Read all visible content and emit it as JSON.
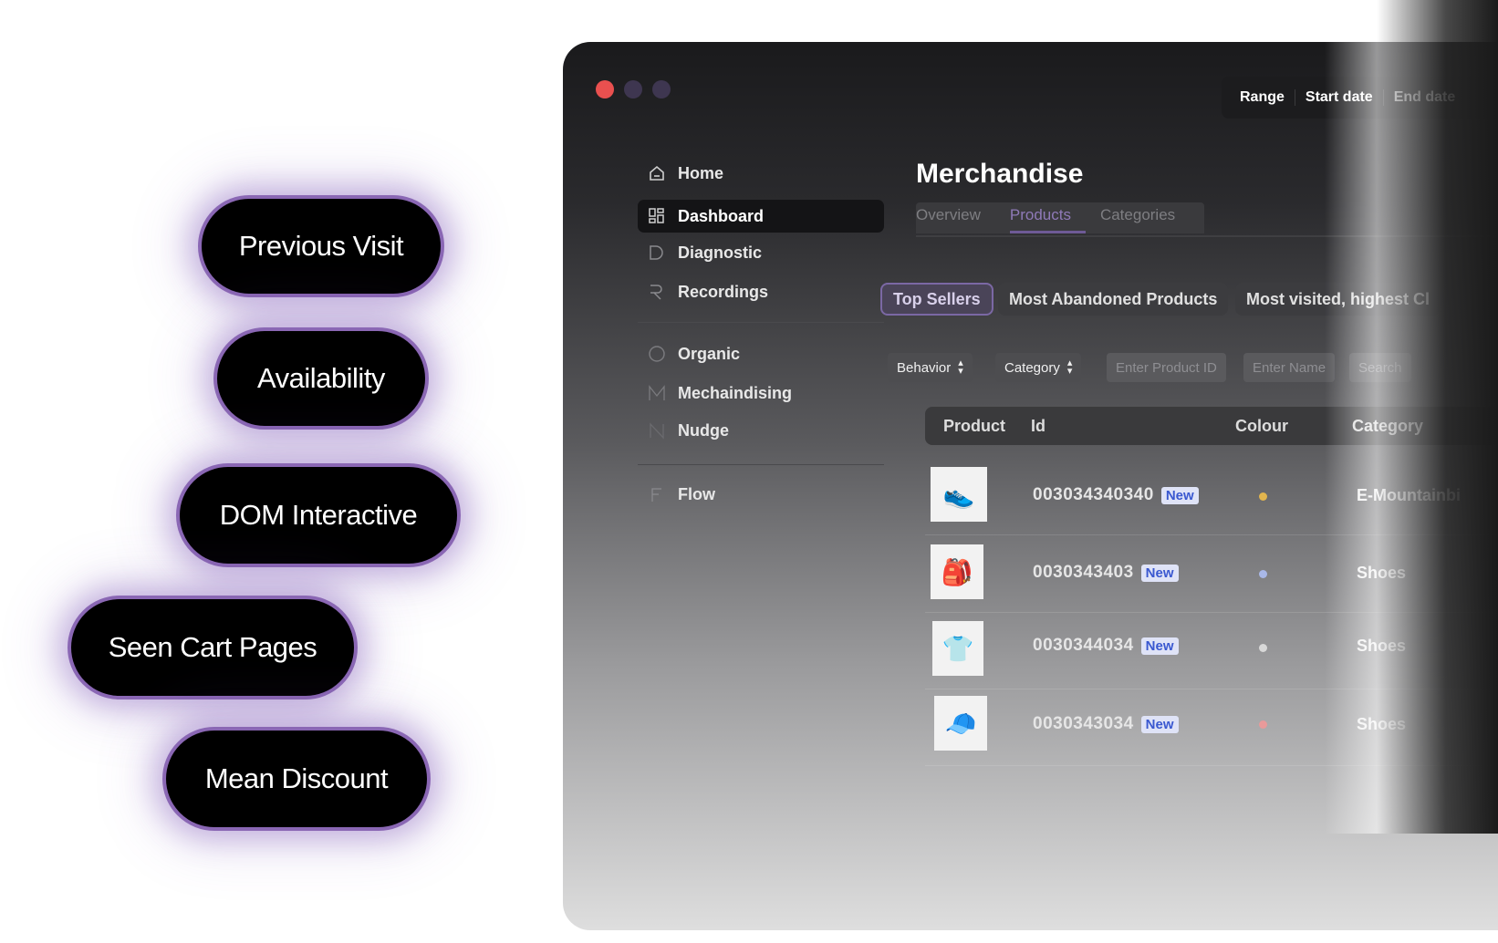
{
  "pills": [
    "Previous Visit",
    "Availability",
    "DOM Interactive",
    "Seen Cart Pages",
    "Mean Discount"
  ],
  "range_bar": {
    "range": "Range",
    "start": "Start date",
    "end": "End date"
  },
  "sidebar": {
    "items": [
      {
        "label": "Home",
        "icon": "home-icon"
      },
      {
        "label": "Dashboard",
        "icon": "grid-icon"
      },
      {
        "label": "Diagnostic",
        "icon": "d-icon"
      },
      {
        "label": "Recordings",
        "icon": "r-icon"
      },
      {
        "label": "Organic",
        "icon": "circle-icon"
      },
      {
        "label": "Mechaindising",
        "icon": "m-icon"
      },
      {
        "label": "Nudge",
        "icon": "n-icon"
      },
      {
        "label": "Flow",
        "icon": "f-icon"
      }
    ]
  },
  "main": {
    "title": "Merchandise",
    "tabs": [
      "Overview",
      "Products",
      "Categories"
    ],
    "chips": [
      "Top Sellers",
      "Most Abandoned Products",
      "Most visited, highest Cl"
    ],
    "filters": {
      "behavior": "Behavior",
      "category": "Category",
      "product_id_placeholder": "Enter Product ID",
      "name_placeholder": "Enter Name",
      "search_placeholder": "Search"
    },
    "table": {
      "headers": [
        "Product",
        "Id",
        "Colour",
        "Category"
      ],
      "rows": [
        {
          "id": "003034340340",
          "badge": "New",
          "dot_color": "#e2b54e",
          "category": "E-Mountainbi",
          "thumb": "shoe-image"
        },
        {
          "id": "0030343403",
          "badge": "New",
          "dot_color": "#a9b8e8",
          "category": "Shoes",
          "thumb": "backpack-image"
        },
        {
          "id": "0030344034",
          "badge": "New",
          "dot_color": "#d8d8d8",
          "category": "Shoes",
          "thumb": "shirt-image"
        },
        {
          "id": "0030343034",
          "badge": "New",
          "dot_color": "#e89a9a",
          "category": "Shoes",
          "thumb": "cap-image"
        }
      ]
    }
  }
}
